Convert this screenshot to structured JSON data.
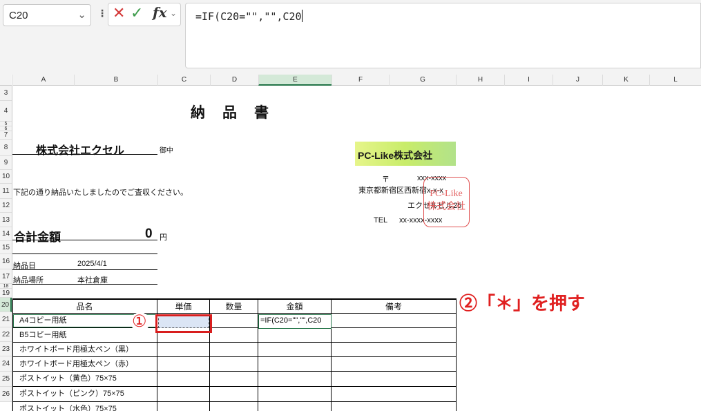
{
  "name_box": {
    "value": "C20",
    "chevron": "⌄"
  },
  "formula_bar": {
    "cancel_icon": "✕",
    "enter_icon": "✓",
    "fx_label": "fx",
    "fx_chevron": "⌄",
    "formula": "=IF(C20=\"\",\"\",C20"
  },
  "columns": [
    "A",
    "B",
    "C",
    "D",
    "E",
    "F",
    "G",
    "H",
    "I",
    "J",
    "K",
    "L"
  ],
  "rows": [
    "3",
    "4",
    "5",
    "6",
    "7",
    "8",
    "9",
    "10",
    "11",
    "12",
    "13",
    "14",
    "15",
    "16",
    "17",
    "18",
    "19",
    "20",
    "21",
    "22",
    "23",
    "24",
    "25",
    "26"
  ],
  "selected": {
    "column": "E",
    "row": "20"
  },
  "doc": {
    "title": "納　品　書",
    "customer": "株式会社エクセル",
    "honorific": "御中",
    "message": "下記の通り納品いたしましたのでご査収ください。",
    "total_label": "合計金額",
    "total_value": "0",
    "total_unit": "円",
    "delivery_date_label": "納品日",
    "delivery_date_value": "2025/4/1",
    "delivery_place_label": "納品場所",
    "delivery_place_value": "本社倉庫"
  },
  "company": {
    "logo_text": "PC-Like株式会社",
    "postal_mark": "〒",
    "postal_code": "xxx-xxxx",
    "address1": "東京都新宿区西新宿x-x-x",
    "address2": "エクセルビル25",
    "phone_label": "TEL",
    "phone": "xx-xxxx-xxxx",
    "stamp_line1": "PC-Like",
    "stamp_line2": "株式会社"
  },
  "table": {
    "headers": [
      "品名",
      "単価",
      "数量",
      "金額",
      "備考"
    ],
    "items": [
      "A4コピー用紙",
      "B5コピー用紙",
      "ホワイトボード用極太ペン（黒）",
      "ホワイトボード用極太ペン（赤）",
      "ポストイット（黄色）75×75",
      "ポストイット（ピンク）75×75",
      "ポストイット（水色）75×75"
    ],
    "editing_cell_text": "=IF(C20=\"\",\"\",C20"
  },
  "annotations": {
    "step1": "①",
    "step2": "②「＊」を押す"
  },
  "colors": {
    "accent_green": "#217346",
    "annotation_red": "#e02020",
    "stamp_red": "#e05050"
  }
}
